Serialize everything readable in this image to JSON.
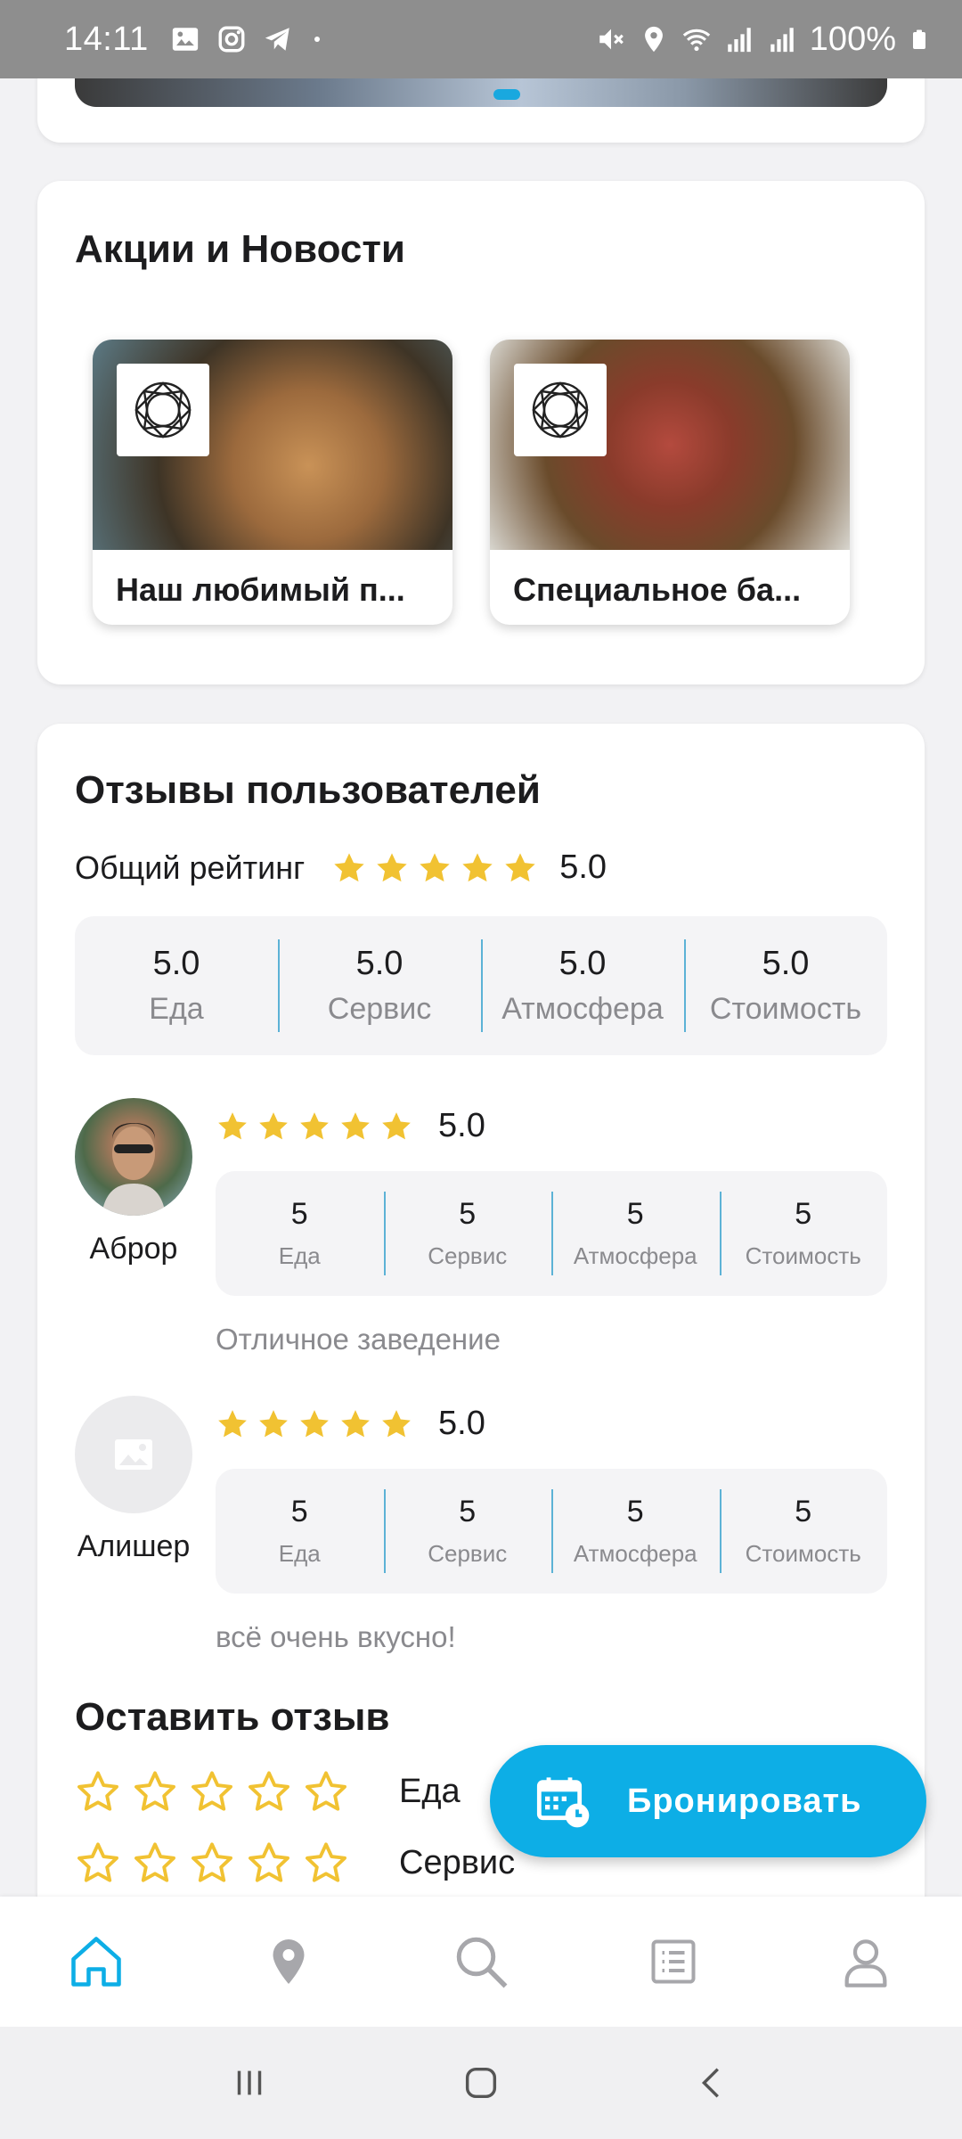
{
  "status_bar": {
    "time": "14:11",
    "battery": "100%"
  },
  "news": {
    "title": "Акции и Новости",
    "items": [
      {
        "label": "Наш любимый п..."
      },
      {
        "label": "Специальное ба..."
      }
    ]
  },
  "reviews": {
    "title": "Отзывы пользователей",
    "overall_label": "Общий рейтинг",
    "overall_value": "5.0",
    "overall_rating_stars": 5,
    "categories": [
      {
        "value": "5.0",
        "label": "Еда"
      },
      {
        "value": "5.0",
        "label": "Сервис"
      },
      {
        "value": "5.0",
        "label": "Атмосфера"
      },
      {
        "value": "5.0",
        "label": "Стоимость"
      }
    ],
    "items": [
      {
        "name": "Аброр",
        "rating": "5.0",
        "stars": 5,
        "scores": [
          {
            "value": "5",
            "label": "Еда"
          },
          {
            "value": "5",
            "label": "Сервис"
          },
          {
            "value": "5",
            "label": "Атмосфера"
          },
          {
            "value": "5",
            "label": "Стоимость"
          }
        ],
        "text": "Отличное заведение"
      },
      {
        "name": "Алишер",
        "rating": "5.0",
        "stars": 5,
        "scores": [
          {
            "value": "5",
            "label": "Еда"
          },
          {
            "value": "5",
            "label": "Сервис"
          },
          {
            "value": "5",
            "label": "Атмосфера"
          },
          {
            "value": "5",
            "label": "Стоимость"
          }
        ],
        "text": "всё очень вкусно!"
      }
    ]
  },
  "leave_review": {
    "title": "Оставить отзыв",
    "rows": [
      {
        "label": "Еда",
        "rating": 0
      },
      {
        "label": "Сервис",
        "rating": 0
      }
    ]
  },
  "booking_button": {
    "label": "Бронировать"
  },
  "colors": {
    "accent": "#0daee6",
    "star": "#f1c232",
    "divider": "#5cb2d6"
  },
  "bottom_nav": {
    "items": [
      {
        "icon": "home-icon",
        "active": true
      },
      {
        "icon": "location-pin-icon",
        "active": false
      },
      {
        "icon": "search-icon",
        "active": false
      },
      {
        "icon": "list-icon",
        "active": false
      },
      {
        "icon": "profile-icon",
        "active": false
      }
    ]
  }
}
